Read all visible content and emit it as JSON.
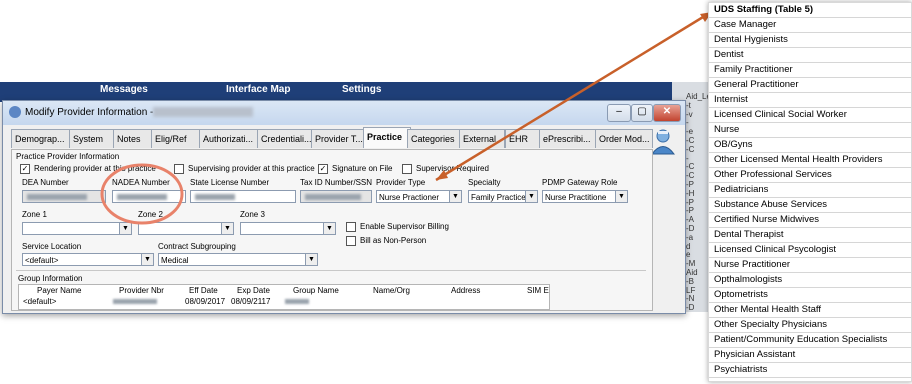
{
  "background": {
    "tabs": [
      "Messages",
      "Interface Map",
      "Settings"
    ],
    "side_text": [
      "Aid_Lega",
      "-t",
      "-v",
      "-",
      "-e",
      "-C",
      "-C",
      "-",
      "-C",
      "-C",
      "-P",
      "-H",
      "-P",
      "-P",
      "-A",
      "-D",
      "-a",
      "d",
      "e",
      "-M",
      "Aid",
      "-B",
      "LF",
      "-N",
      "-D"
    ]
  },
  "dialog": {
    "title": "Modify Provider Information -",
    "window_buttons": [
      "–",
      "▢",
      "✕"
    ],
    "tabs": [
      "Demograp...",
      "System",
      "Notes",
      "Elig/Ref",
      "Authorizati...",
      "Credentiali...",
      "Provider T...",
      "Practice",
      "Categories",
      "External",
      "EHR",
      "ePrescribi...",
      "Order Mod..."
    ],
    "active_tab": "Practice",
    "group_label": "Practice Provider Information",
    "checks": {
      "rendering": {
        "label": "Rendering provider at this practice",
        "checked": true
      },
      "supervising": {
        "label": "Supervising provider at this practice",
        "checked": false
      },
      "signature": {
        "label": "Signature on File",
        "checked": true
      },
      "supervisor_required": {
        "label": "Supervisor Required",
        "checked": false
      },
      "enable_supervisor_billing": {
        "label": "Enable Supervisor Billing",
        "checked": false
      },
      "bill_non_person": {
        "label": "Bill as Non-Person",
        "checked": false
      }
    },
    "labels": {
      "dea": "DEA Number",
      "nadea": "NADEA Number",
      "state_license": "State License Number",
      "tax_id": "Tax ID Number/SSN",
      "provider_type": "Provider Type",
      "specialty": "Specialty",
      "pdmp": "PDMP Gateway Role",
      "zone1": "Zone 1",
      "zone2": "Zone 2",
      "zone3": "Zone 3",
      "service_location": "Service Location",
      "contract_subgrouping": "Contract Subgrouping",
      "group_info": "Group Information"
    },
    "values": {
      "provider_type": "Nurse Practioner",
      "specialty": "Family Practice",
      "pdmp": "Nurse Practitione",
      "service_location": "<default>",
      "contract_subgrouping": "Medical"
    },
    "group_table": {
      "headers": [
        "Payer Name",
        "Provider Nbr",
        "Eff Date",
        "Exp Date",
        "Group Name",
        "Name/Org",
        "Address",
        "SIM E"
      ],
      "row": [
        "<default>",
        "",
        "08/09/2017",
        "08/09/2117",
        "",
        "",
        "",
        ""
      ]
    }
  },
  "uds_list": {
    "header": "UDS Staffing (Table 5)",
    "items": [
      "Case Manager",
      "Dental Hygienists",
      "Dentist",
      "Family Practitioner",
      "General Practitioner",
      "Internist",
      "Licensed Clinical Social Worker",
      "Nurse",
      "OB/Gyns",
      "Other Licensed Mental Health Providers",
      "Other Professional Services",
      "Pediatricians",
      "Substance Abuse Services",
      "Certified Nurse Midwives",
      "Dental Therapist",
      "Licensed Clinical Psycologist",
      "Nurse Practitioner",
      "Opthalmologists",
      "Optometrists",
      "Other Mental Health Staff",
      "Other Specialty Physicians",
      "Patient/Community Education Specialists",
      "Physician Assistant",
      "Psychiatrists"
    ]
  },
  "colors": {
    "annotation_orange": "#c8602a",
    "circle_orange": "#e8826a",
    "title_blue": "#1f3f78"
  }
}
